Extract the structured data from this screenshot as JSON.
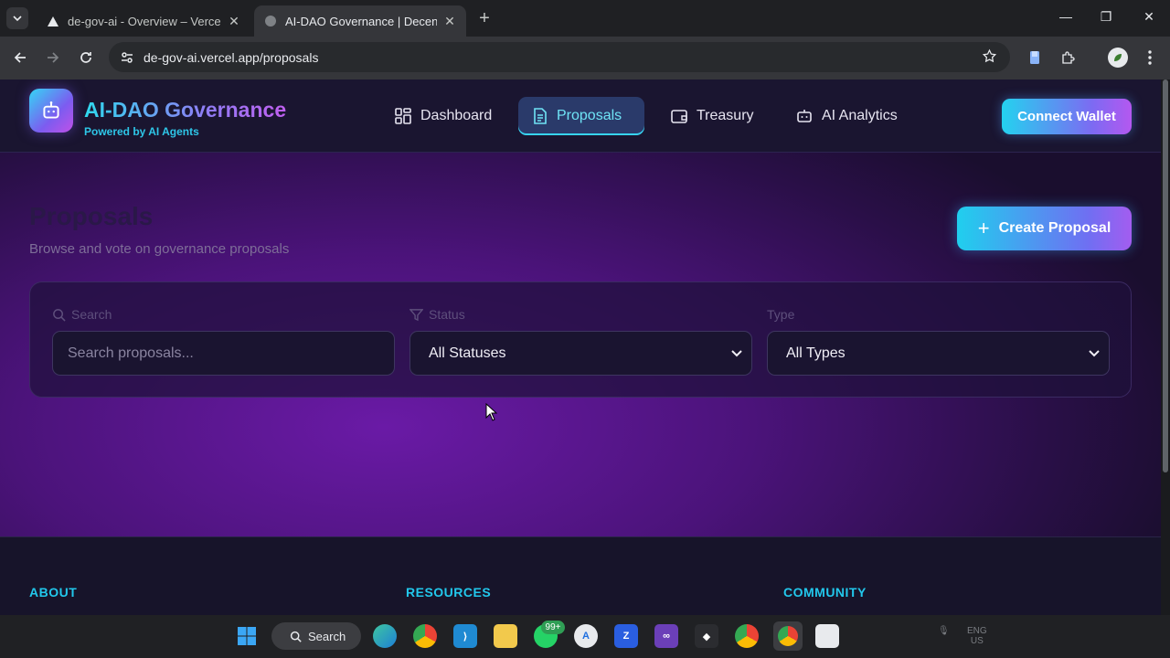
{
  "browser": {
    "tabs": [
      {
        "title": "de-gov-ai - Overview – Vercel",
        "active": false
      },
      {
        "title": "AI-DAO Governance | Decentral",
        "active": true
      }
    ],
    "url": "de-gov-ai.vercel.app/proposals"
  },
  "app": {
    "brand_title": "AI-DAO Governance",
    "brand_subtitle": "Powered by AI Agents",
    "nav": [
      {
        "label": "Dashboard",
        "icon": "grid-icon",
        "active": false
      },
      {
        "label": "Proposals",
        "icon": "document-icon",
        "active": true
      },
      {
        "label": "Treasury",
        "icon": "wallet-icon",
        "active": false
      },
      {
        "label": "AI Analytics",
        "icon": "bot-icon",
        "active": false
      }
    ],
    "connect_label": "Connect Wallet"
  },
  "main": {
    "title": "Proposals",
    "subtitle": "Browse and vote on governance proposals",
    "create_label": "Create Proposal",
    "filters": {
      "search_label": "Search",
      "search_placeholder": "Search proposals...",
      "status_label": "Status",
      "status_value": "All Statuses",
      "type_label": "Type",
      "type_value": "All Types"
    }
  },
  "footer": {
    "headings": [
      "ABOUT",
      "RESOURCES",
      "COMMUNITY"
    ]
  },
  "taskbar": {
    "search_label": "Search",
    "whatsapp_badge": "99+",
    "tray_lang": "ENG",
    "tray_region": "US"
  },
  "colors": {
    "accent_cyan": "#22c8ec",
    "accent_purple": "#8f7df5",
    "page_purple": "#6a1aa6"
  }
}
